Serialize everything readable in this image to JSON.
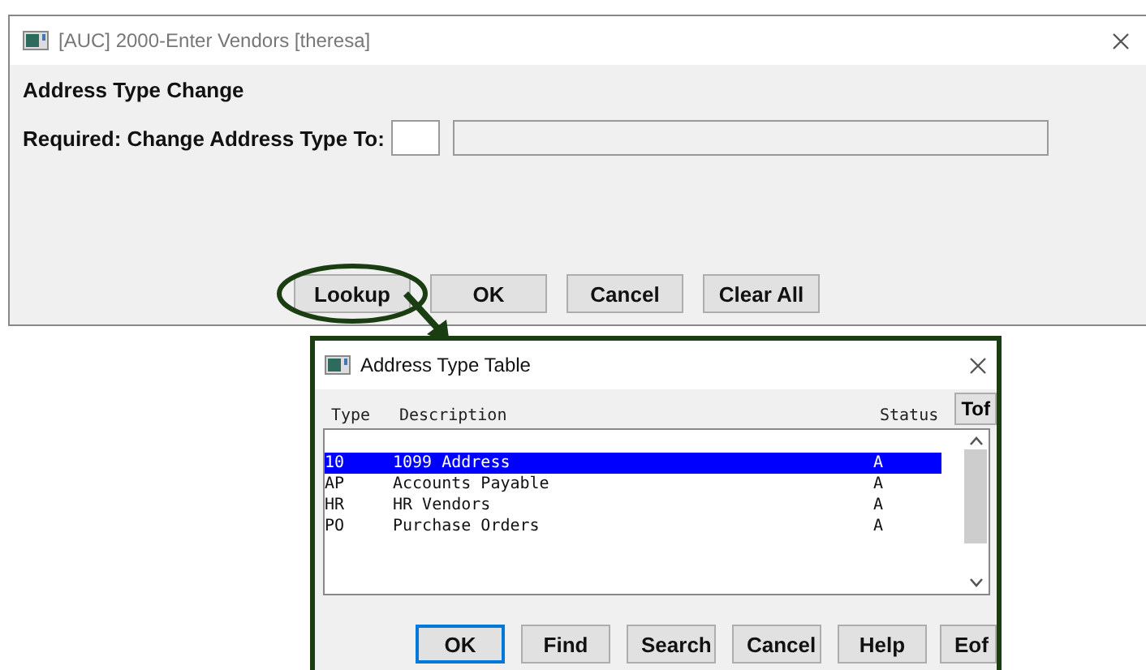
{
  "window": {
    "title": "[AUC] 2000-Enter Vendors [theresa]"
  },
  "form": {
    "heading": "Address Type Change",
    "field_label": "Required: Change Address Type To:"
  },
  "buttons": [
    {
      "label": "Lookup",
      "highlighted": true
    },
    {
      "label": "OK",
      "highlighted": false
    },
    {
      "label": "Cancel",
      "highlighted": false
    },
    {
      "label": "Clear All",
      "highlighted": false
    }
  ],
  "lookup_window": {
    "title": "Address Type Table",
    "columns": [
      "Type",
      "Description",
      "Status"
    ],
    "tof_button": "Tof",
    "rows": [
      {
        "type": "10",
        "description": "1099 Address",
        "status": "A",
        "selected": true
      },
      {
        "type": "AP",
        "description": "Accounts Payable",
        "status": "A",
        "selected": false
      },
      {
        "type": "HR",
        "description": "HR Vendors",
        "status": "A",
        "selected": false
      },
      {
        "type": "PO",
        "description": "Purchase Orders",
        "status": "A",
        "selected": false
      }
    ],
    "buttons": [
      {
        "label": "OK",
        "default": true
      },
      {
        "label": "Find",
        "default": false
      },
      {
        "label": "Search",
        "default": false
      },
      {
        "label": "Cancel",
        "default": false
      },
      {
        "label": "Help",
        "default": false
      }
    ],
    "eof_button": "Eof"
  }
}
